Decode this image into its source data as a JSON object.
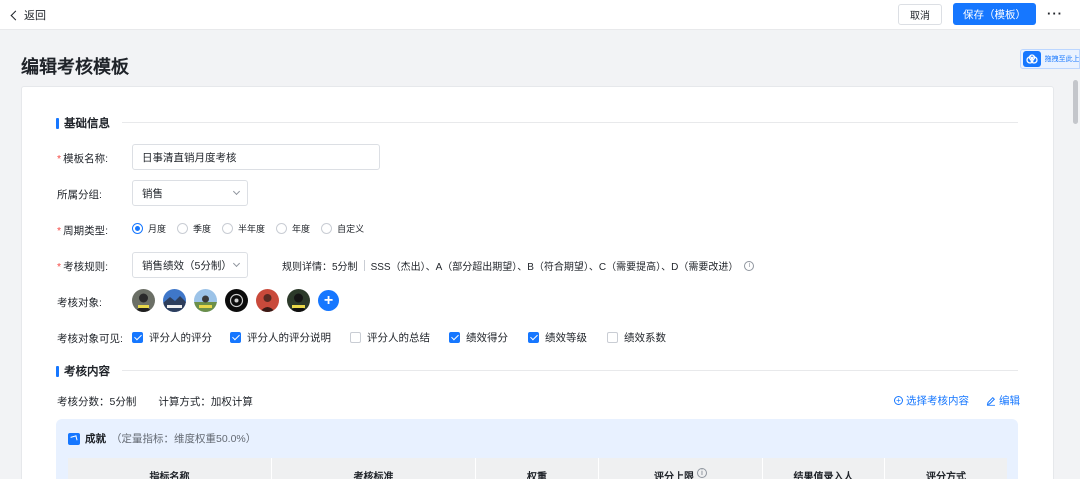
{
  "topbar": {
    "back_label": "返回",
    "cancel_label": "取消",
    "save_label": "保存（模板）",
    "more_label": "···"
  },
  "page": {
    "title": "编辑考核模板",
    "float_label": "拖拽至此上"
  },
  "basic": {
    "section_title": "基础信息",
    "name_label": "模板名称:",
    "name_value": "日事清直销月度考核",
    "group_label": "所属分组:",
    "group_value": "销售",
    "period_label": "周期类型:",
    "period_options": [
      "月度",
      "季度",
      "半年度",
      "年度",
      "自定义"
    ],
    "period_selected": "月度",
    "rule_label": "考核规则:",
    "rule_value": "销售绩效（5分制）",
    "rule_detail_prefix": "规则详情：5分制",
    "rule_detail_text": "SSS（杰出）、A（部分超出期望）、B（符合期望）、C（需要提高）、D（需要改进）",
    "target_label": "考核对象:",
    "visible_label": "考核对象可见:",
    "visible_options": [
      {
        "label": "评分人的评分",
        "checked": true
      },
      {
        "label": "评分人的评分说明",
        "checked": true
      },
      {
        "label": "评分人的总结",
        "checked": false
      },
      {
        "label": "绩效得分",
        "checked": true
      },
      {
        "label": "绩效等级",
        "checked": true
      },
      {
        "label": "绩效系数",
        "checked": false
      }
    ]
  },
  "content": {
    "section_title": "考核内容",
    "score_label": "考核分数：5分制",
    "calc_label": "计算方式：加权计算",
    "select_link": "选择考核内容",
    "edit_link": "编辑",
    "dimension_name": "成就",
    "dimension_desc": "（定量指标：维度权重50.0%）",
    "table_headers": [
      "指标名称",
      "考核标准",
      "权重",
      "评分上限",
      "结果值录入人",
      "评分方式"
    ]
  },
  "colors": {
    "primary": "#1677ff",
    "required": "#f54a45"
  }
}
